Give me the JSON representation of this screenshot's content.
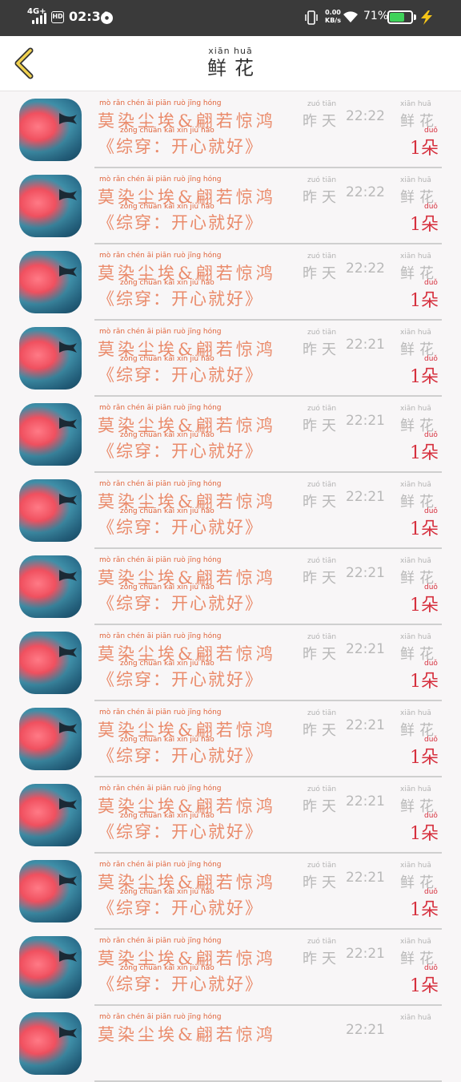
{
  "status_bar": {
    "network": "4G+",
    "hd": "HD",
    "time": "02:34",
    "speed_value": "0.00",
    "speed_unit": "KB/s",
    "battery_percent": "71%",
    "battery_level": 0.71
  },
  "nav": {
    "title_pinyin": "xiān huā",
    "title": "鲜花",
    "back_icon": "chevron-left-icon"
  },
  "colors": {
    "name_text": "#ea8b6b",
    "quantity_text": "#d6303e",
    "meta_text": "#b8b8b8"
  },
  "records": [
    {
      "name": "莫染尘埃&翩若惊鸿",
      "name_pinyin": "mò rǎn chén āi piān ruò jīng hóng",
      "topic": "《综穿：开心就好》",
      "topic_pinyin": "zōng chuān kāi xīn jiù hǎo",
      "day": "昨天",
      "day_pinyin": "zuó tiān",
      "time": "22:22",
      "gift": "鲜花",
      "gift_pinyin": "xiān huā",
      "quantity": "1朵",
      "quantity_pinyin": "duǒ"
    },
    {
      "name": "莫染尘埃&翩若惊鸿",
      "name_pinyin": "mò rǎn chén āi piān ruò jīng hóng",
      "topic": "《综穿：开心就好》",
      "topic_pinyin": "zōng chuān kāi xīn jiù hǎo",
      "day": "昨天",
      "day_pinyin": "zuó tiān",
      "time": "22:22",
      "gift": "鲜花",
      "gift_pinyin": "xiān huā",
      "quantity": "1朵",
      "quantity_pinyin": "duǒ"
    },
    {
      "name": "莫染尘埃&翩若惊鸿",
      "name_pinyin": "mò rǎn chén āi piān ruò jīng hóng",
      "topic": "《综穿：开心就好》",
      "topic_pinyin": "zōng chuān kāi xīn jiù hǎo",
      "day": "昨天",
      "day_pinyin": "zuó tiān",
      "time": "22:22",
      "gift": "鲜花",
      "gift_pinyin": "xiān huā",
      "quantity": "1朵",
      "quantity_pinyin": "duǒ"
    },
    {
      "name": "莫染尘埃&翩若惊鸿",
      "name_pinyin": "mò rǎn chén āi piān ruò jīng hóng",
      "topic": "《综穿：开心就好》",
      "topic_pinyin": "zōng chuān kāi xīn jiù hǎo",
      "day": "昨天",
      "day_pinyin": "zuó tiān",
      "time": "22:21",
      "gift": "鲜花",
      "gift_pinyin": "xiān huā",
      "quantity": "1朵",
      "quantity_pinyin": "duǒ"
    },
    {
      "name": "莫染尘埃&翩若惊鸿",
      "name_pinyin": "mò rǎn chén āi piān ruò jīng hóng",
      "topic": "《综穿：开心就好》",
      "topic_pinyin": "zōng chuān kāi xīn jiù hǎo",
      "day": "昨天",
      "day_pinyin": "zuó tiān",
      "time": "22:21",
      "gift": "鲜花",
      "gift_pinyin": "xiān huā",
      "quantity": "1朵",
      "quantity_pinyin": "duǒ"
    },
    {
      "name": "莫染尘埃&翩若惊鸿",
      "name_pinyin": "mò rǎn chén āi piān ruò jīng hóng",
      "topic": "《综穿：开心就好》",
      "topic_pinyin": "zōng chuān kāi xīn jiù hǎo",
      "day": "昨天",
      "day_pinyin": "zuó tiān",
      "time": "22:21",
      "gift": "鲜花",
      "gift_pinyin": "xiān huā",
      "quantity": "1朵",
      "quantity_pinyin": "duǒ"
    },
    {
      "name": "莫染尘埃&翩若惊鸿",
      "name_pinyin": "mò rǎn chén āi piān ruò jīng hóng",
      "topic": "《综穿：开心就好》",
      "topic_pinyin": "zōng chuān kāi xīn jiù hǎo",
      "day": "昨天",
      "day_pinyin": "zuó tiān",
      "time": "22:21",
      "gift": "鲜花",
      "gift_pinyin": "xiān huā",
      "quantity": "1朵",
      "quantity_pinyin": "duǒ"
    },
    {
      "name": "莫染尘埃&翩若惊鸿",
      "name_pinyin": "mò rǎn chén āi piān ruò jīng hóng",
      "topic": "《综穿：开心就好》",
      "topic_pinyin": "zōng chuān kāi xīn jiù hǎo",
      "day": "昨天",
      "day_pinyin": "zuó tiān",
      "time": "22:21",
      "gift": "鲜花",
      "gift_pinyin": "xiān huā",
      "quantity": "1朵",
      "quantity_pinyin": "duǒ"
    },
    {
      "name": "莫染尘埃&翩若惊鸿",
      "name_pinyin": "mò rǎn chén āi piān ruò jīng hóng",
      "topic": "《综穿：开心就好》",
      "topic_pinyin": "zōng chuān kāi xīn jiù hǎo",
      "day": "昨天",
      "day_pinyin": "zuó tiān",
      "time": "22:21",
      "gift": "鲜花",
      "gift_pinyin": "xiān huā",
      "quantity": "1朵",
      "quantity_pinyin": "duǒ"
    },
    {
      "name": "莫染尘埃&翩若惊鸿",
      "name_pinyin": "mò rǎn chén āi piān ruò jīng hóng",
      "topic": "《综穿：开心就好》",
      "topic_pinyin": "zōng chuān kāi xīn jiù hǎo",
      "day": "昨天",
      "day_pinyin": "zuó tiān",
      "time": "22:21",
      "gift": "鲜花",
      "gift_pinyin": "xiān huā",
      "quantity": "1朵",
      "quantity_pinyin": "duǒ"
    },
    {
      "name": "莫染尘埃&翩若惊鸿",
      "name_pinyin": "mò rǎn chén āi piān ruò jīng hóng",
      "topic": "《综穿：开心就好》",
      "topic_pinyin": "zōng chuān kāi xīn jiù hǎo",
      "day": "昨天",
      "day_pinyin": "zuó tiān",
      "time": "22:21",
      "gift": "鲜花",
      "gift_pinyin": "xiān huā",
      "quantity": "1朵",
      "quantity_pinyin": "duǒ"
    },
    {
      "name": "莫染尘埃&翩若惊鸿",
      "name_pinyin": "mò rǎn chén āi piān ruò jīng hóng",
      "topic": "《综穿：开心就好》",
      "topic_pinyin": "zōng chuān kāi xīn jiù hǎo",
      "day": "昨天",
      "day_pinyin": "zuó tiān",
      "time": "22:21",
      "gift": "鲜花",
      "gift_pinyin": "xiān huā",
      "quantity": "1朵",
      "quantity_pinyin": "duǒ"
    },
    {
      "name": "莫染尘埃&翩若惊鸿",
      "name_pinyin": "mò rǎn chén āi piān ruò jīng hóng",
      "topic": "",
      "topic_pinyin": "",
      "day": "",
      "day_pinyin": "",
      "time": "22:21",
      "gift": "",
      "gift_pinyin": "xiān huā",
      "quantity": "",
      "quantity_pinyin": ""
    }
  ]
}
